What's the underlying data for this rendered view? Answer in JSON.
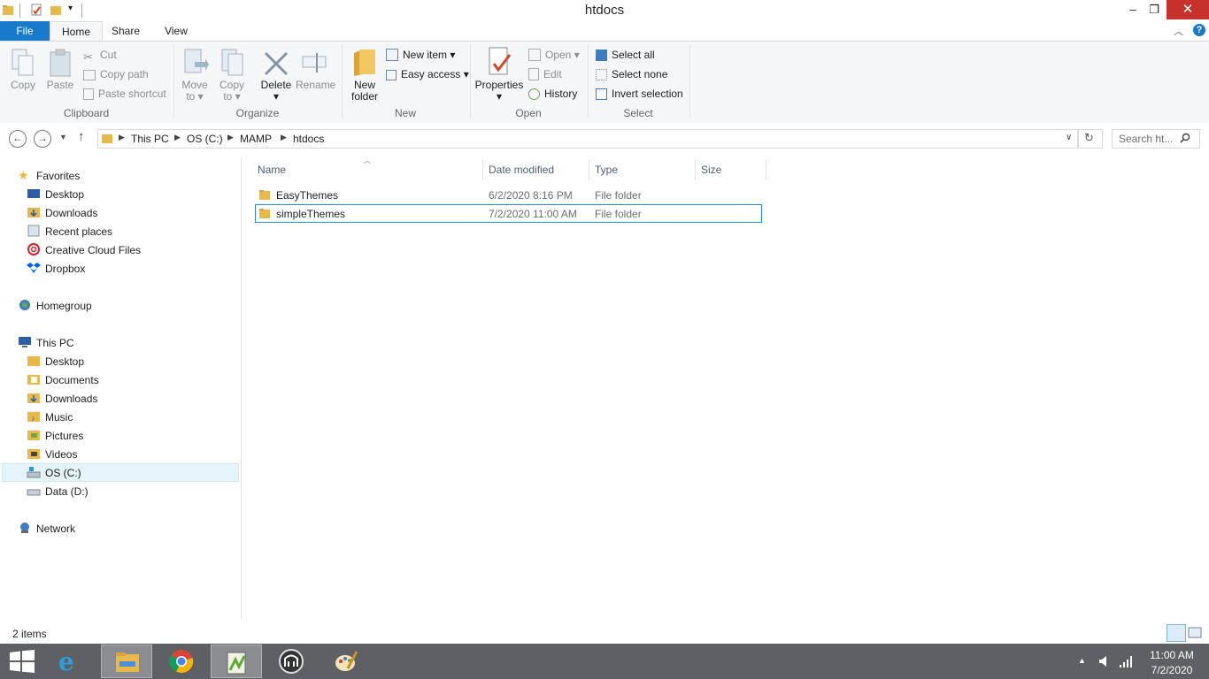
{
  "window": {
    "title": "htdocs",
    "minimize": "–",
    "maximize": "❐",
    "close": "✕"
  },
  "ribbon_tabs": [
    "File",
    "Home",
    "Share",
    "View"
  ],
  "ribbon": {
    "clipboard": {
      "label": "Clipboard",
      "copy": "Copy",
      "paste": "Paste",
      "cut": "Cut",
      "copy_path": "Copy path",
      "paste_shortcut": "Paste shortcut"
    },
    "organize": {
      "label": "Organize",
      "move_to_1": "Move",
      "move_to_2": "to",
      "copy_to_1": "Copy",
      "copy_to_2": "to",
      "delete": "Delete",
      "rename": "Rename"
    },
    "new": {
      "label": "New",
      "new_folder_1": "New",
      "new_folder_2": "folder",
      "new_item": "New item",
      "easy_access": "Easy access"
    },
    "open": {
      "label": "Open",
      "properties": "Properties",
      "open": "Open",
      "edit": "Edit",
      "history": "History"
    },
    "select": {
      "label": "Select",
      "select_all": "Select all",
      "select_none": "Select none",
      "invert": "Invert selection"
    }
  },
  "address": {
    "crumbs": [
      "This PC",
      "OS (C:)",
      "MAMP",
      "htdocs"
    ],
    "search_placeholder": "Search ht..."
  },
  "nav": {
    "favorites": {
      "label": "Favorites",
      "items": [
        "Desktop",
        "Downloads",
        "Recent places",
        "Creative Cloud Files",
        "Dropbox"
      ]
    },
    "homegroup": "Homegroup",
    "this_pc": {
      "label": "This PC",
      "items": [
        "Desktop",
        "Documents",
        "Downloads",
        "Music",
        "Pictures",
        "Videos",
        "OS (C:)",
        "Data (D:)"
      ]
    },
    "network": "Network"
  },
  "columns": [
    "Name",
    "Date modified",
    "Type",
    "Size"
  ],
  "files": [
    {
      "name": "EasyThemes",
      "date": "6/2/2020 8:16 PM",
      "type": "File folder",
      "size": ""
    },
    {
      "name": "simpleThemes",
      "date": "7/2/2020 11:00 AM",
      "type": "File folder",
      "size": ""
    }
  ],
  "status": {
    "count": "2 items"
  },
  "taskbar": {
    "time": "11:00 AM",
    "date": "7/2/2020"
  },
  "colors": {
    "accent": "#1979ca",
    "taskbar": "#5f6063",
    "folder": "#e8b84a",
    "selection": "#2a8cd6"
  }
}
